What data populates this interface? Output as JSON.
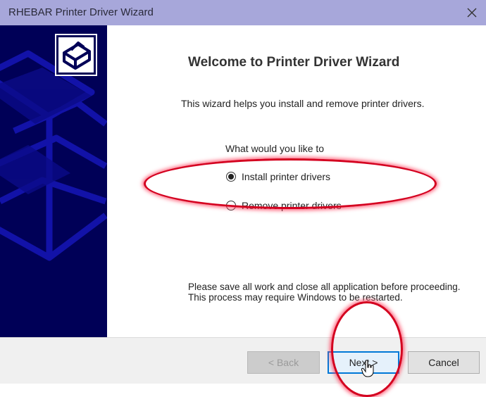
{
  "window": {
    "title": "RHEBAR Printer Driver Wizard",
    "close_icon": "close-icon"
  },
  "sidebar": {
    "logo_icon": "printer-icon",
    "background_color": "#000057",
    "art_color": "#0d0d9e"
  },
  "main": {
    "heading": "Welcome to Printer Driver Wizard",
    "intro": "This wizard helps you install and remove printer drivers.",
    "question": "What would you like to",
    "options": [
      {
        "label": "Install printer drivers",
        "selected": true
      },
      {
        "label": "Remove printer drivers",
        "selected": false
      }
    ],
    "note_line1": "Please save all work and close all application before proceeding.",
    "note_line2": "This process may require Windows to be restarted."
  },
  "footer": {
    "back_label": "< Back",
    "back_enabled": false,
    "next_label": "Next >",
    "cancel_label": "Cancel"
  },
  "annotations": {
    "highlight_color": "#d4001f"
  }
}
